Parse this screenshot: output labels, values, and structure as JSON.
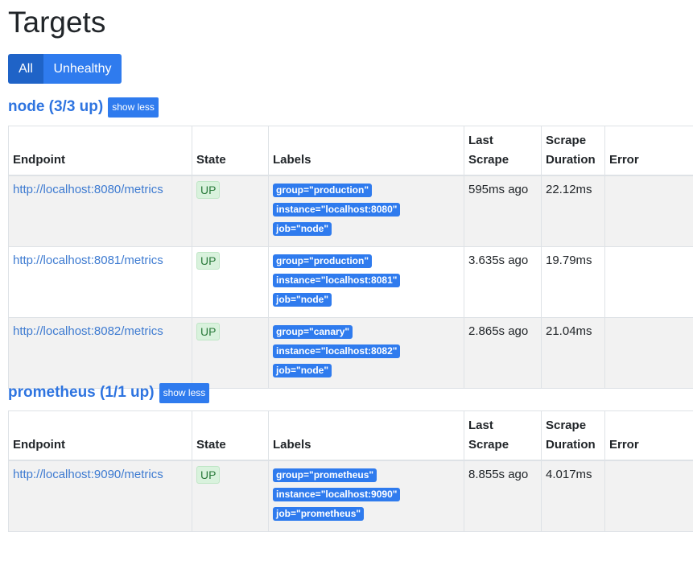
{
  "page": {
    "title": "Targets"
  },
  "filters": {
    "all_label": "All",
    "unhealthy_label": "Unhealthy"
  },
  "table_headers": {
    "endpoint": "Endpoint",
    "state": "State",
    "labels": "Labels",
    "last_scrape": "Last Scrape",
    "scrape_duration_line1": "Scrape",
    "scrape_duration_line2": "Duration",
    "error": "Error"
  },
  "pools": [
    {
      "title": "node (3/3 up)",
      "toggle_label": "show less",
      "targets": [
        {
          "endpoint": "http://localhost:8080/metrics",
          "state": "UP",
          "labels": [
            "group=\"production\"",
            "instance=\"localhost:8080\"",
            "job=\"node\""
          ],
          "last_scrape": "595ms ago",
          "scrape_duration": "22.12ms",
          "error": ""
        },
        {
          "endpoint": "http://localhost:8081/metrics",
          "state": "UP",
          "labels": [
            "group=\"production\"",
            "instance=\"localhost:8081\"",
            "job=\"node\""
          ],
          "last_scrape": "3.635s ago",
          "scrape_duration": "19.79ms",
          "error": ""
        },
        {
          "endpoint": "http://localhost:8082/metrics",
          "state": "UP",
          "labels": [
            "group=\"canary\"",
            "instance=\"localhost:8082\"",
            "job=\"node\""
          ],
          "last_scrape": "2.865s ago",
          "scrape_duration": "21.04ms",
          "error": ""
        }
      ]
    },
    {
      "title": "prometheus (1/1 up)",
      "toggle_label": "show less",
      "targets": [
        {
          "endpoint": "http://localhost:9090/metrics",
          "state": "UP",
          "labels": [
            "group=\"prometheus\"",
            "instance=\"localhost:9090\"",
            "job=\"prometheus\""
          ],
          "last_scrape": "8.855s ago",
          "scrape_duration": "4.017ms",
          "error": ""
        }
      ]
    }
  ]
}
